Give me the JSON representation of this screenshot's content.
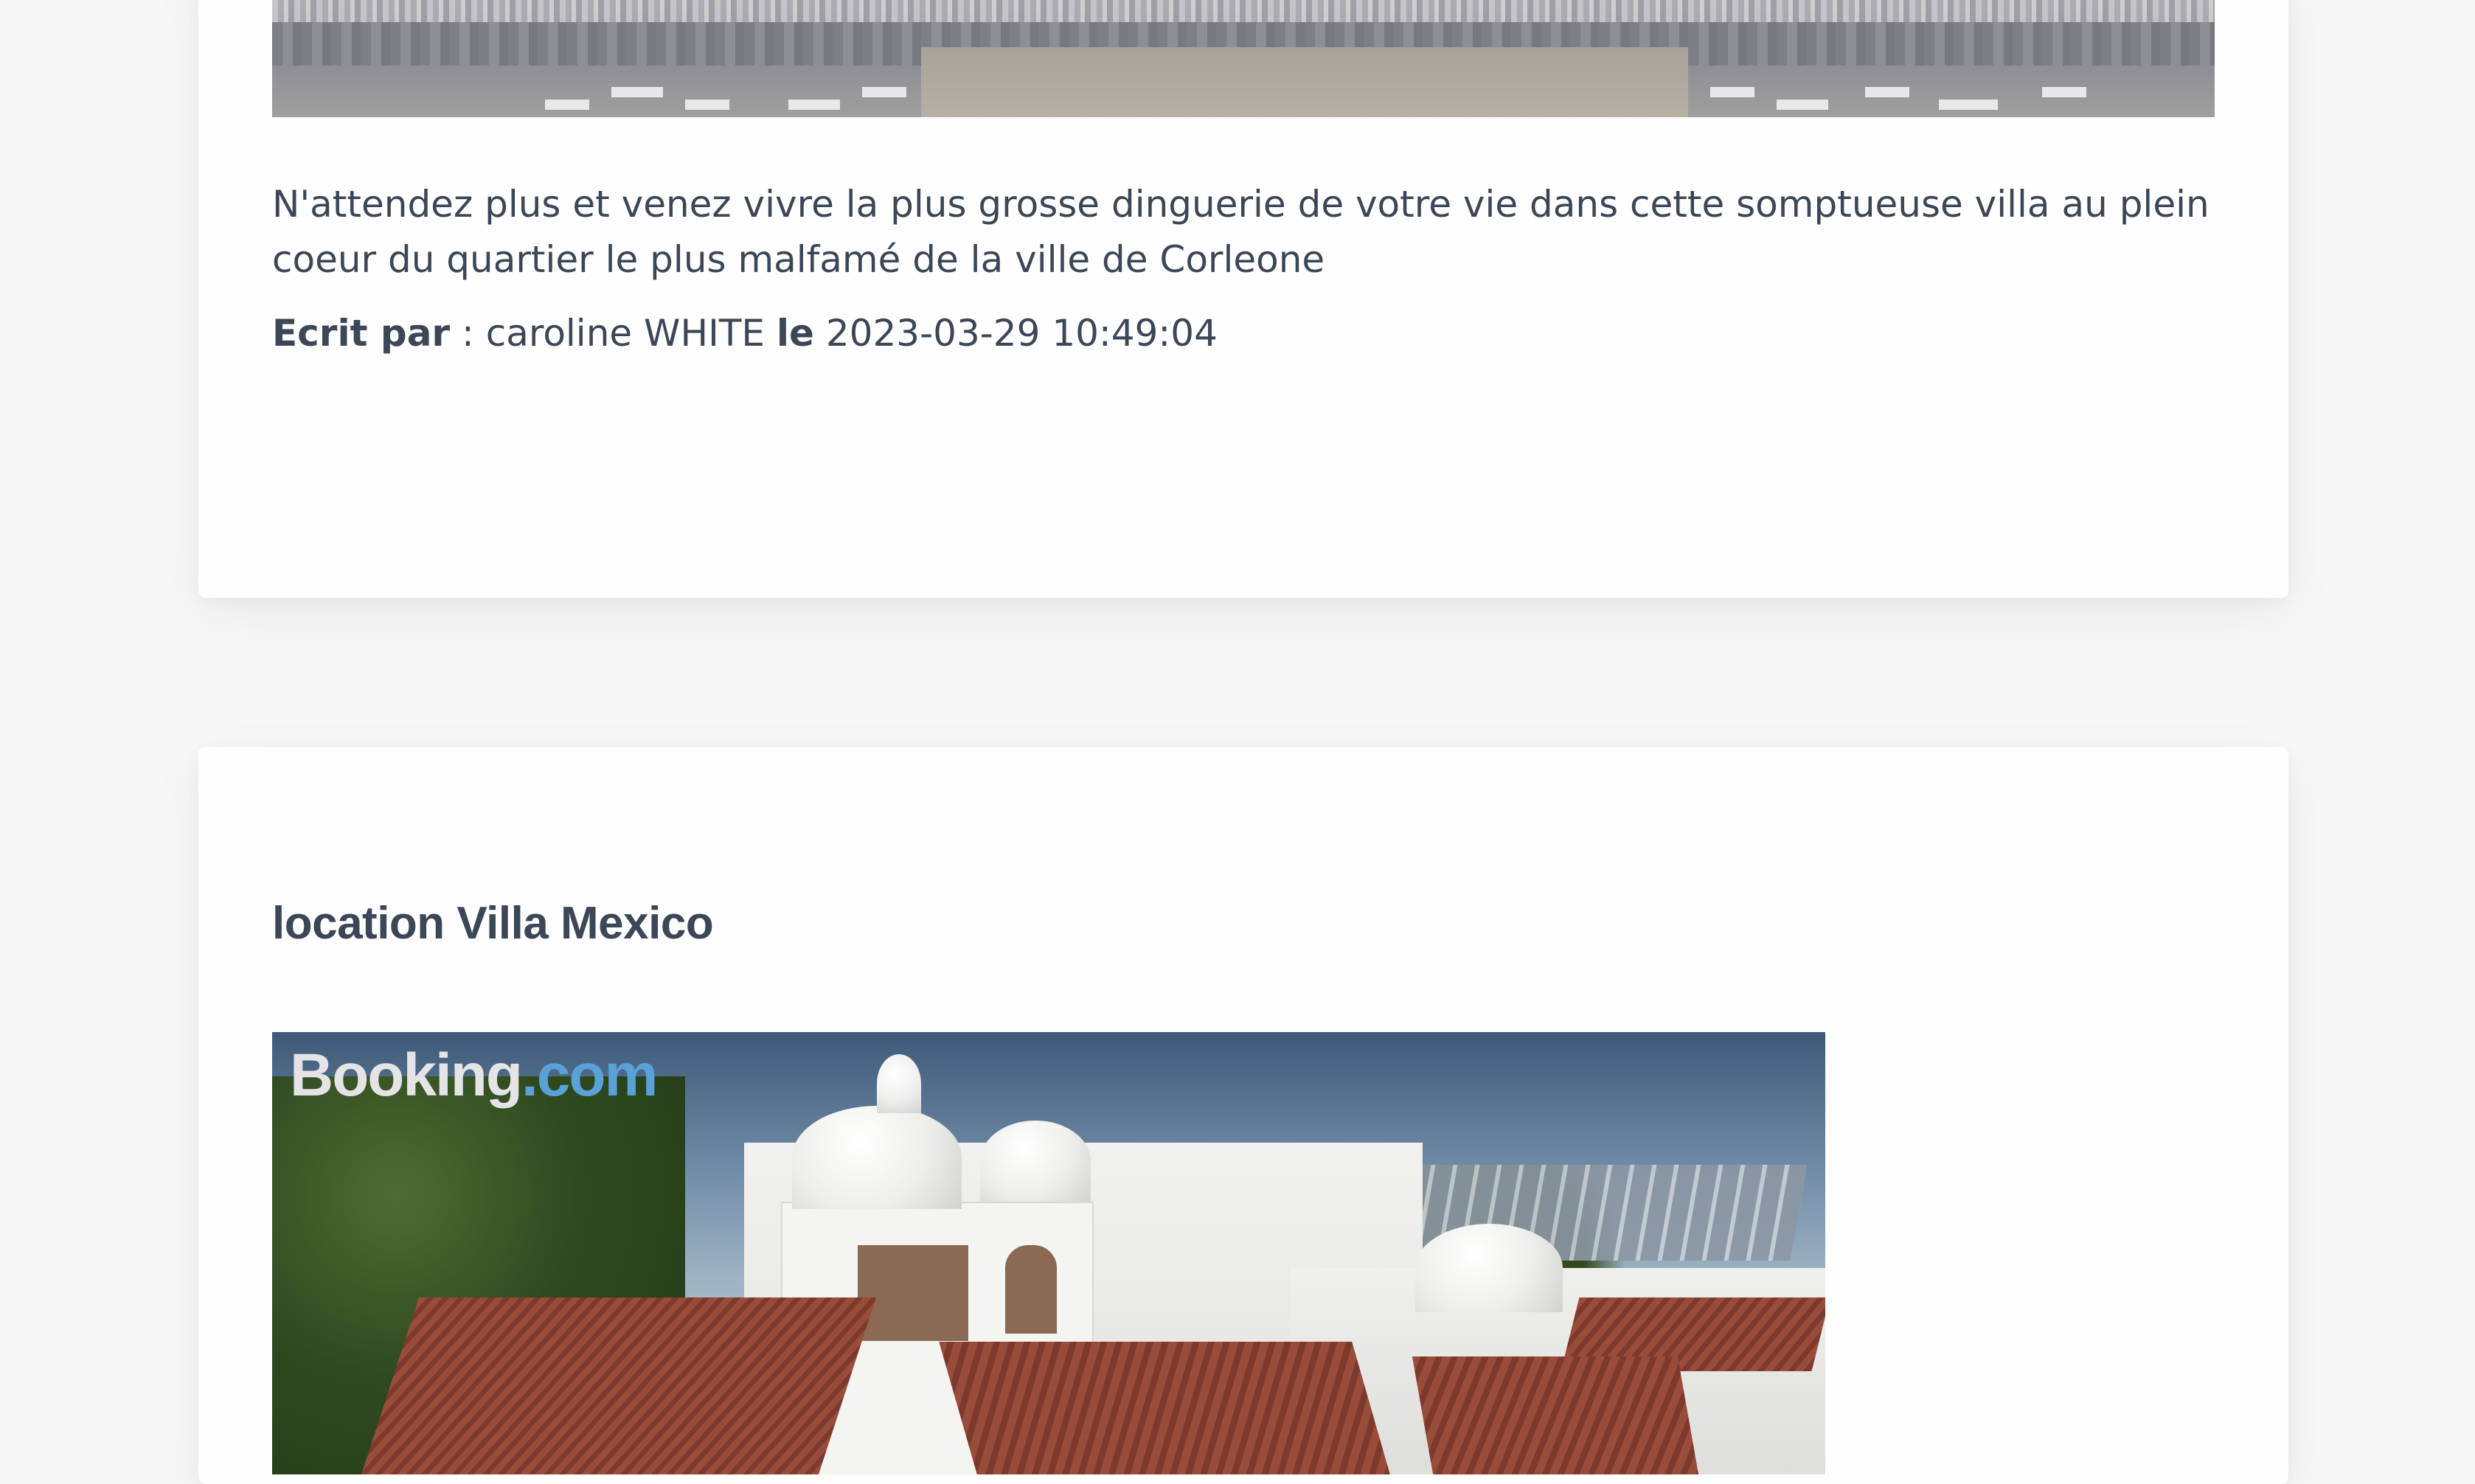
{
  "posts": [
    {
      "description": "N'attendez plus et venez vivre la plus grosse dinguerie de votre vie dans cette somptueuse villa au plein coeur du quartier le plus malfamé de la ville de Corleone",
      "meta": {
        "written_by_label": "Ecrit par",
        "separator": " : ",
        "author": "caroline WHITE",
        "date_label": "le",
        "date": "2023-03-29 10:49:04"
      }
    },
    {
      "title": "location Villa Mexico",
      "image_watermark": {
        "part1": "Booking",
        "part2": ".com"
      }
    }
  ]
}
